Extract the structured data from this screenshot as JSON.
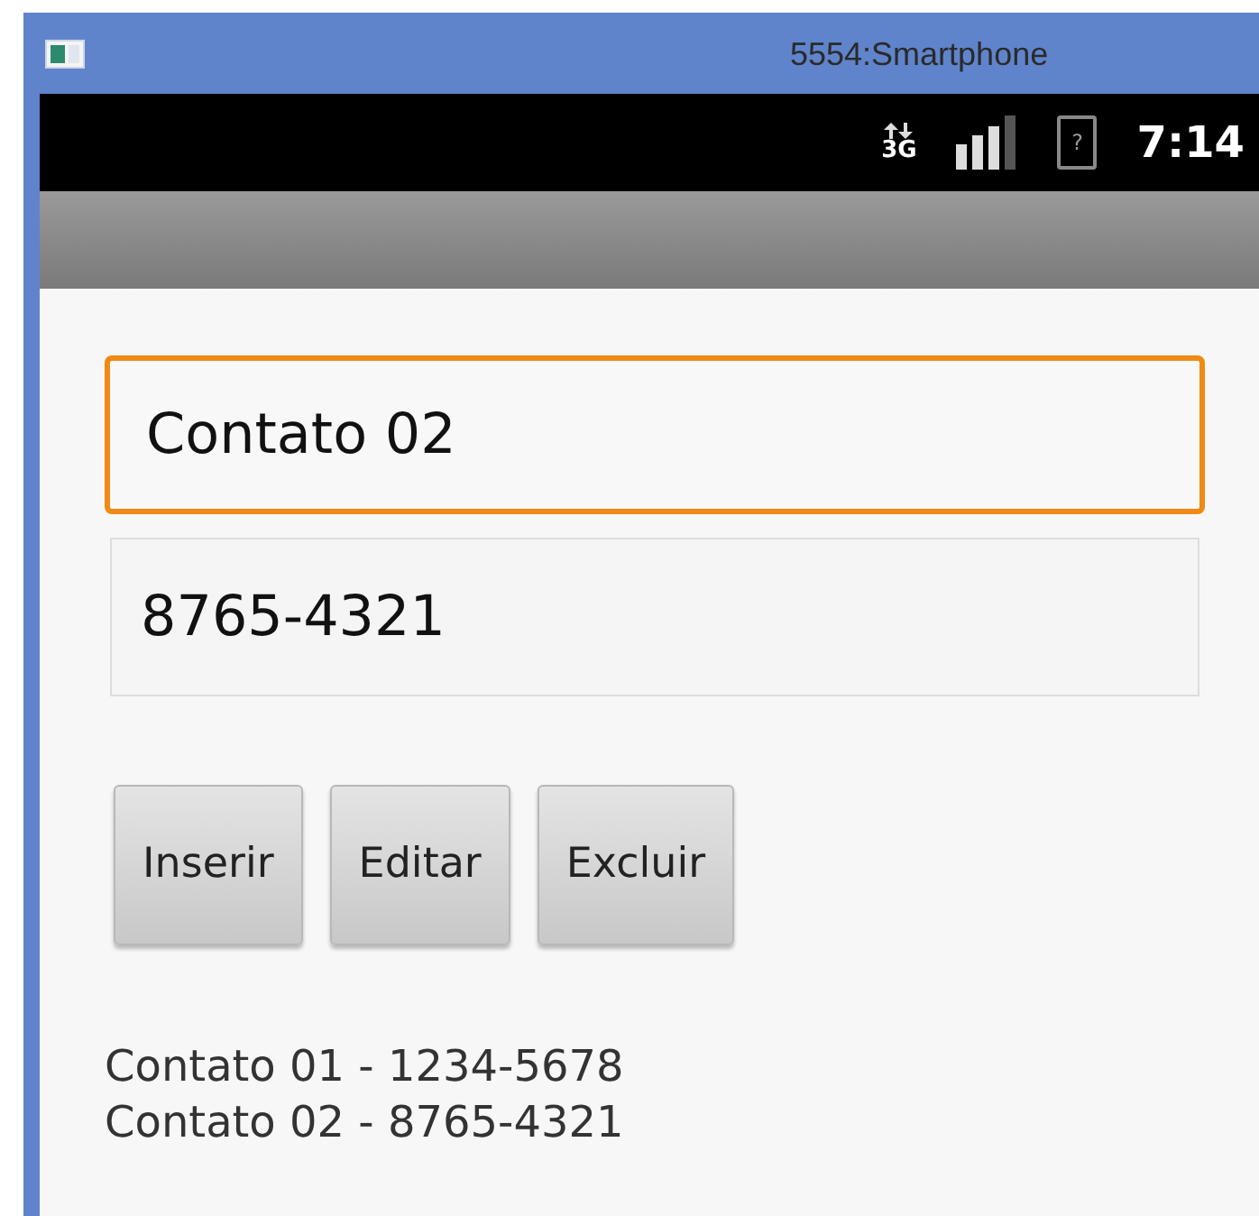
{
  "window": {
    "title": "5554:Smartphone"
  },
  "status_bar": {
    "network": "3G",
    "battery": "?",
    "time": "7:14"
  },
  "fields": [
    {
      "value": "Contato 02",
      "focused": true
    },
    {
      "value": "8765-4321",
      "focused": false
    }
  ],
  "buttons": [
    "Inserir",
    "Editar",
    "Excluir"
  ],
  "contacts": [
    "Contato 01 - 1234-5678",
    "Contato 02 - 8765-4321"
  ]
}
